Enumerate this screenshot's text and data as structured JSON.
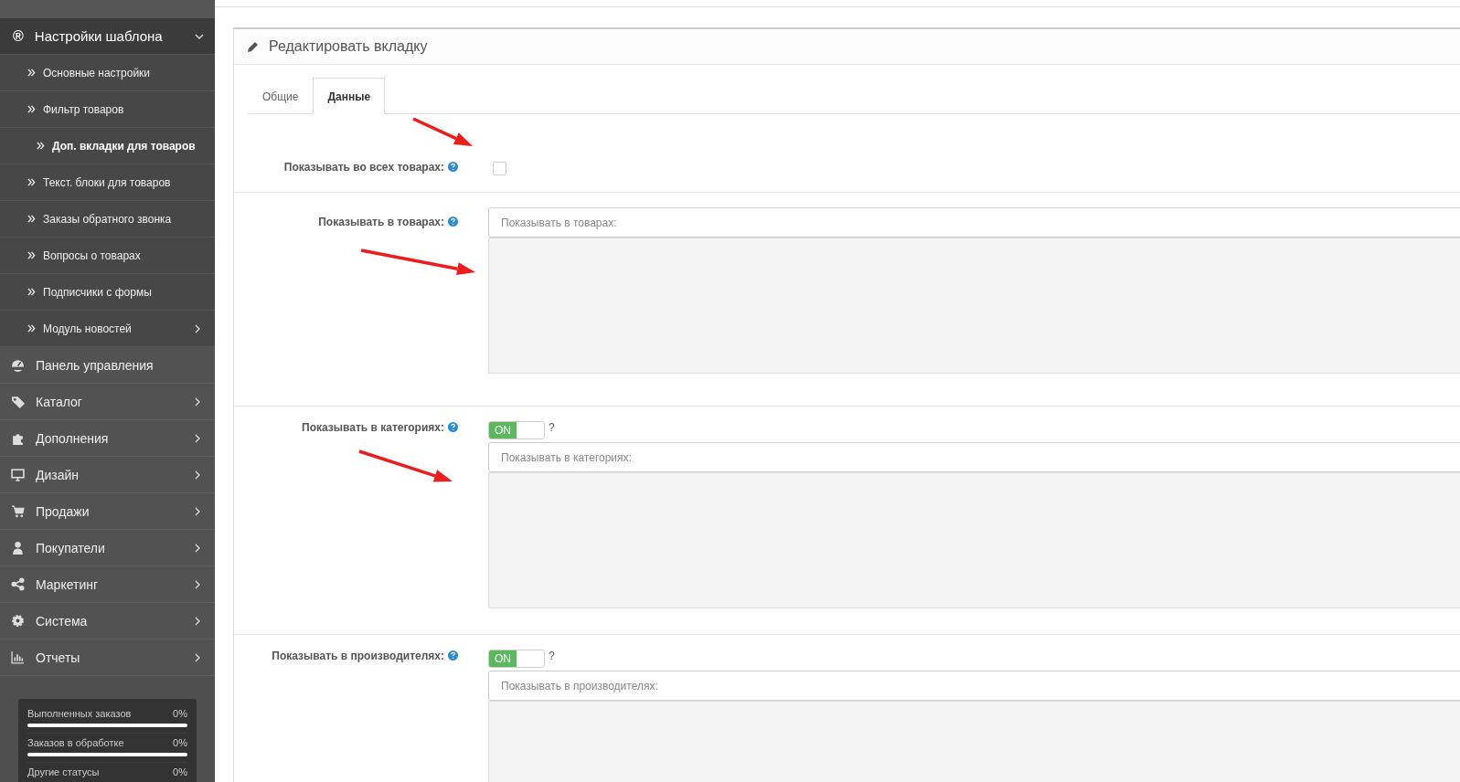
{
  "sidebar": {
    "section": {
      "icon": "®",
      "label": "Настройки шаблона",
      "expanded": true
    },
    "subitems": [
      {
        "label": "Основные настройки",
        "selected": false,
        "has_submenu": false
      },
      {
        "label": "Фильтр товаров",
        "selected": false,
        "has_submenu": false
      },
      {
        "label": "Доп. вкладки для товаров",
        "selected": true,
        "has_submenu": false
      },
      {
        "label": "Текст. блоки для товаров",
        "selected": false,
        "has_submenu": false
      },
      {
        "label": "Заказы обратного звонка",
        "selected": false,
        "has_submenu": false
      },
      {
        "label": "Вопросы о товарах",
        "selected": false,
        "has_submenu": false
      },
      {
        "label": "Подписчики с формы",
        "selected": false,
        "has_submenu": false
      },
      {
        "label": "Модуль новостей",
        "selected": false,
        "has_submenu": true
      }
    ],
    "menu": [
      {
        "label": "Панель управления",
        "kind": "dashboard",
        "has_submenu": false
      },
      {
        "label": "Каталог",
        "kind": "tags",
        "has_submenu": true
      },
      {
        "label": "Дополнения",
        "kind": "puzzle",
        "has_submenu": true
      },
      {
        "label": "Дизайн",
        "kind": "monitor",
        "has_submenu": true
      },
      {
        "label": "Продажи",
        "kind": "cart",
        "has_submenu": true
      },
      {
        "label": "Покупатели",
        "kind": "user",
        "has_submenu": true
      },
      {
        "label": "Маркетинг",
        "kind": "share",
        "has_submenu": true
      },
      {
        "label": "Система",
        "kind": "gear",
        "has_submenu": true
      },
      {
        "label": "Отчеты",
        "kind": "chart",
        "has_submenu": true
      }
    ],
    "stats": [
      {
        "label": "Выполненных заказов",
        "value": "0%",
        "level": 0
      },
      {
        "label": "Заказов в обработке",
        "value": "0%",
        "level": 0
      },
      {
        "label": "Другие статусы",
        "value": "0%"
      }
    ]
  },
  "panel": {
    "title": "Редактировать вкладку",
    "tabs": [
      {
        "label": "Общие",
        "selected": false
      },
      {
        "label": "Данные",
        "selected": true
      }
    ],
    "fields": [
      {
        "kind": "checkbox",
        "label": "Показывать во всех товарах:",
        "checked": false
      },
      {
        "kind": "autocomplete",
        "label": "Показывать в товарах:",
        "placeholder": "Показывать в товарах:"
      },
      {
        "kind": "autocomplete",
        "label": "Показывать в категориях:",
        "toggle": {
          "label": "ON",
          "on": true,
          "hint": "?"
        },
        "placeholder": "Показывать в категориях:"
      },
      {
        "kind": "autocomplete",
        "label": "Показывать в производителях:",
        "toggle": {
          "label": "ON",
          "on": true,
          "hint": "?"
        },
        "placeholder": "Показывать в производителях:"
      }
    ]
  }
}
